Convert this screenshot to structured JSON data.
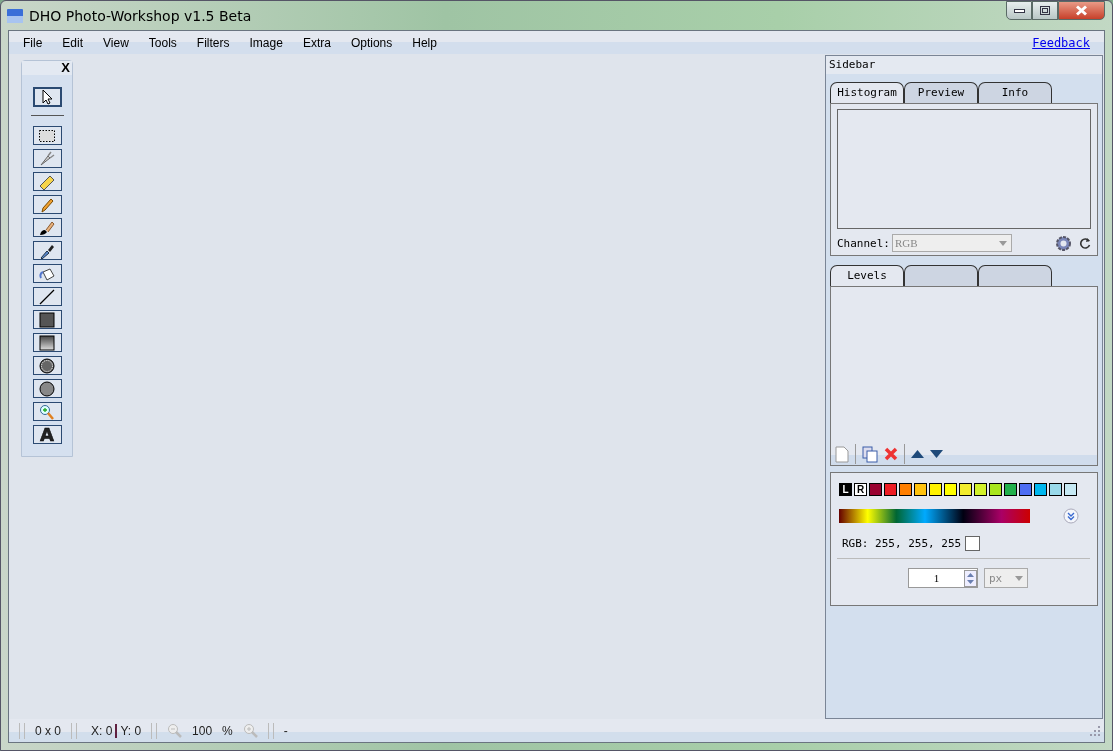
{
  "window": {
    "title": "DHO Photo-Workshop v1.5 Beta"
  },
  "menu": [
    "File",
    "Edit",
    "View",
    "Tools",
    "Filters",
    "Image",
    "Extra",
    "Options",
    "Help"
  ],
  "feedback_link": "Feedback",
  "toolbox": {
    "close": "X",
    "tools": [
      {
        "kind": "pointer",
        "selected": true
      },
      {
        "kind": "select-rect",
        "selected": false
      },
      {
        "kind": "cutter",
        "selected": false
      },
      {
        "kind": "ruler",
        "selected": false
      },
      {
        "kind": "pencil",
        "selected": false
      },
      {
        "kind": "brush",
        "selected": false
      },
      {
        "kind": "eyedropper",
        "selected": false
      },
      {
        "kind": "bucket",
        "selected": false
      },
      {
        "kind": "line",
        "selected": false
      },
      {
        "kind": "rect",
        "selected": false
      },
      {
        "kind": "rect-gradient",
        "selected": false
      },
      {
        "kind": "ellipse",
        "selected": false
      },
      {
        "kind": "ellipse-filled",
        "selected": false
      },
      {
        "kind": "zoom",
        "selected": false
      },
      {
        "kind": "text",
        "glyph": "A",
        "selected": false
      }
    ]
  },
  "sidebar": {
    "title": "Sidebar",
    "tabs": [
      {
        "label": "Histogram",
        "selected": true
      },
      {
        "label": "Preview",
        "selected": false
      },
      {
        "label": "Info",
        "selected": false
      }
    ],
    "channel_label": "Channel:",
    "channel_value": "RGB",
    "layer_tabs": [
      {
        "label": "Levels",
        "selected": true
      },
      {
        "selected": false
      },
      {
        "selected": false
      }
    ],
    "swatches": [
      {
        "label": "L",
        "color": "#000000"
      },
      {
        "label": "R",
        "color": "#ffffff"
      },
      {
        "color": "#990030"
      },
      {
        "color": "#ed1c24"
      },
      {
        "color": "#ff7e00"
      },
      {
        "color": "#ffc20e"
      },
      {
        "color": "#fff200"
      },
      {
        "color": "#ffff00"
      },
      {
        "color": "#f2ec2d"
      },
      {
        "color": "#d2f12a"
      },
      {
        "color": "#a8e61d"
      },
      {
        "color": "#22b14c"
      },
      {
        "color": "#4d6df3"
      },
      {
        "color": "#00b7ef"
      },
      {
        "color": "#99d9ea"
      },
      {
        "color": "#c6e9f4"
      }
    ],
    "rgb_reading": "RGB: 255, 255, 255",
    "size_value": "1",
    "size_unit": "px"
  },
  "status_bar": {
    "size": "0 x 0",
    "x": "X: 0",
    "y": "Y: 0",
    "zoom": "100",
    "zoom_unit": "%",
    "info": "-"
  }
}
